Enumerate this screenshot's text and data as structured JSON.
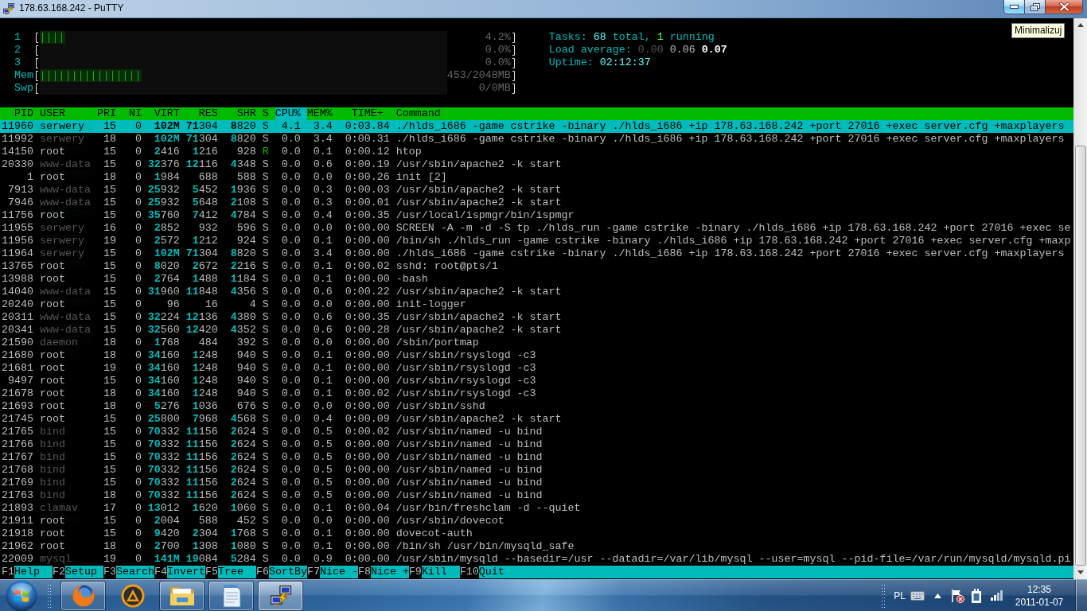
{
  "window": {
    "title": "178.63.168.242 - PuTTY",
    "buttons": [
      {
        "kind": "minimize",
        "hovered": true
      },
      {
        "kind": "restore",
        "hovered": false
      },
      {
        "kind": "close",
        "hovered": false
      }
    ],
    "tooltip": "Minimalizuj"
  },
  "meters": [
    {
      "label": "1",
      "level": 0.0625,
      "reading": "4.2%"
    },
    {
      "label": "2",
      "reading": "0.0%"
    },
    {
      "label": "3",
      "reading": "0.0%"
    },
    {
      "label": "Mem",
      "level": 0.25,
      "reading": "453/2048MB"
    },
    {
      "label": "Swp",
      "reading": "0/0MB"
    }
  ],
  "summary": [
    {
      "parts": [
        {
          "kind": "label",
          "text": "Tasks:"
        },
        {
          "kind": "value",
          "text": "68"
        },
        {
          "kind": "label",
          "text": "total,"
        },
        {
          "kind": "running",
          "text": "1"
        },
        {
          "kind": "label",
          "text": "running"
        }
      ]
    },
    {
      "parts": [
        {
          "kind": "label",
          "text": "Load average:"
        },
        {
          "kind": "dim",
          "text": "0.00"
        },
        {
          "kind": "plain",
          "text": "0.06"
        },
        {
          "kind": "bright",
          "text": "0.07"
        }
      ]
    },
    {
      "parts": [
        {
          "kind": "label",
          "text": "Uptime:"
        },
        {
          "kind": "value",
          "text": "02:12:37"
        }
      ]
    }
  ],
  "table": {
    "columns": [
      {
        "label": "PID",
        "selected": false
      },
      {
        "label": "USER",
        "selected": false
      },
      {
        "label": "PRI",
        "selected": false
      },
      {
        "label": "NI",
        "selected": false
      },
      {
        "label": "VIRT",
        "selected": false
      },
      {
        "label": "RES",
        "selected": false
      },
      {
        "label": "SHR",
        "selected": false
      },
      {
        "label": "S",
        "selected": false
      },
      {
        "label": "CPU%",
        "selected": true
      },
      {
        "label": "MEM%",
        "selected": false
      },
      {
        "label": "TIME+",
        "selected": false
      },
      {
        "label": "Command",
        "selected": false
      }
    ],
    "rows": [
      {
        "pid": "11960",
        "user": "serwery",
        "shadowed": true,
        "pri": "15",
        "ni": "0",
        "virt": "**102M**",
        "res": "**71**304",
        "shr": "**8**820",
        "state": "S",
        "running": false,
        "cpu": "4.1",
        "mem": "3.4",
        "time": "0:03.84",
        "command": "./hlds_i686 -game cstrike -binary ./hlds_i686 +ip 178.63.168.242 +port 27016 +exec server.cfg +maxplayers",
        "selected": true
      },
      {
        "pid": "11992",
        "user": "serwery",
        "shadowed": true,
        "pri": "18",
        "ni": "0",
        "virt": "**102M**",
        "res": "**71**304",
        "shr": "**8**820",
        "state": "S",
        "running": false,
        "cpu": "0.0",
        "mem": "3.4",
        "time": "0:00.31",
        "command": "./hlds_i686 -game cstrike -binary ./hlds_i686 +ip 178.63.168.242 +port 27016 +exec server.cfg +maxplayers",
        "selected": false
      },
      {
        "pid": "14150",
        "user": "root",
        "shadowed": false,
        "pri": "15",
        "ni": "0",
        "virt": "**2**416",
        "res": "**1**216",
        "shr": "928",
        "state": "R",
        "running": true,
        "cpu": "0.0",
        "mem": "0.1",
        "time": "0:00.12",
        "command": "htop",
        "selected": false
      },
      {
        "pid": "20330",
        "user": "www-data",
        "shadowed": true,
        "pri": "15",
        "ni": "0",
        "virt": "**32**376",
        "res": "**12**116",
        "shr": "**4**348",
        "state": "S",
        "running": false,
        "cpu": "0.0",
        "mem": "0.6",
        "time": "0:00.19",
        "command": "/usr/sbin/apache2 -k start",
        "selected": false
      },
      {
        "pid": "1",
        "user": "root",
        "shadowed": false,
        "pri": "18",
        "ni": "0",
        "virt": "**1**984",
        "res": "688",
        "shr": "588",
        "state": "S",
        "running": false,
        "cpu": "0.0",
        "mem": "0.0",
        "time": "0:00.26",
        "command": "init [2]",
        "selected": false
      },
      {
        "pid": "7913",
        "user": "www-data",
        "shadowed": true,
        "pri": "15",
        "ni": "0",
        "virt": "**25**932",
        "res": "**5**452",
        "shr": "**1**936",
        "state": "S",
        "running": false,
        "cpu": "0.0",
        "mem": "0.3",
        "time": "0:00.03",
        "command": "/usr/sbin/apache2 -k start",
        "selected": false
      },
      {
        "pid": "7946",
        "user": "www-data",
        "shadowed": true,
        "pri": "15",
        "ni": "0",
        "virt": "**25**932",
        "res": "**5**648",
        "shr": "**2**108",
        "state": "S",
        "running": false,
        "cpu": "0.0",
        "mem": "0.3",
        "time": "0:00.01",
        "command": "/usr/sbin/apache2 -k start",
        "selected": false
      },
      {
        "pid": "11756",
        "user": "root",
        "shadowed": false,
        "pri": "15",
        "ni": "0",
        "virt": "**35**760",
        "res": "**7**412",
        "shr": "**4**784",
        "state": "S",
        "running": false,
        "cpu": "0.0",
        "mem": "0.4",
        "time": "0:00.35",
        "command": "/usr/local/ispmgr/bin/ispmgr",
        "selected": false
      },
      {
        "pid": "11955",
        "user": "serwery",
        "shadowed": true,
        "pri": "16",
        "ni": "0",
        "virt": "**2**852",
        "res": "932",
        "shr": "596",
        "state": "S",
        "running": false,
        "cpu": "0.0",
        "mem": "0.0",
        "time": "0:00.00",
        "command": "SCREEN -A -m -d -S tp ./hlds_run -game cstrike -binary ./hlds_i686 +ip 178.63.168.242 +port 27016 +exec se",
        "selected": false
      },
      {
        "pid": "11956",
        "user": "serwery",
        "shadowed": true,
        "pri": "19",
        "ni": "0",
        "virt": "**2**572",
        "res": "**1**212",
        "shr": "924",
        "state": "S",
        "running": false,
        "cpu": "0.0",
        "mem": "0.1",
        "time": "0:00.00",
        "command": "/bin/sh ./hlds_run -game cstrike -binary ./hlds_i686 +ip 178.63.168.242 +port 27016 +exec server.cfg +maxp",
        "selected": false
      },
      {
        "pid": "11964",
        "user": "serwery",
        "shadowed": true,
        "pri": "15",
        "ni": "0",
        "virt": "**102M**",
        "res": "**71**304",
        "shr": "**8**820",
        "state": "S",
        "running": false,
        "cpu": "0.0",
        "mem": "3.4",
        "time": "0:00.00",
        "command": "./hlds_i686 -game cstrike -binary ./hlds_i686 +ip 178.63.168.242 +port 27016 +exec server.cfg +maxplayers",
        "selected": false
      },
      {
        "pid": "13765",
        "user": "root",
        "shadowed": false,
        "pri": "15",
        "ni": "0",
        "virt": "**8**020",
        "res": "**2**672",
        "shr": "**2**216",
        "state": "S",
        "running": false,
        "cpu": "0.0",
        "mem": "0.1",
        "time": "0:00.02",
        "command": "sshd: root@pts/1",
        "selected": false
      },
      {
        "pid": "13988",
        "user": "root",
        "shadowed": false,
        "pri": "15",
        "ni": "0",
        "virt": "**2**764",
        "res": "**1**488",
        "shr": "**1**184",
        "state": "S",
        "running": false,
        "cpu": "0.0",
        "mem": "0.1",
        "time": "0:00.00",
        "command": "-bash",
        "selected": false
      },
      {
        "pid": "14040",
        "user": "www-data",
        "shadowed": true,
        "pri": "15",
        "ni": "0",
        "virt": "**31**960",
        "res": "**11**848",
        "shr": "**4**356",
        "state": "S",
        "running": false,
        "cpu": "0.0",
        "mem": "0.6",
        "time": "0:00.22",
        "command": "/usr/sbin/apache2 -k start",
        "selected": false
      },
      {
        "pid": "20240",
        "user": "root",
        "shadowed": false,
        "pri": "15",
        "ni": "0",
        "virt": "96",
        "res": "16",
        "shr": "4",
        "state": "S",
        "running": false,
        "cpu": "0.0",
        "mem": "0.0",
        "time": "0:00.00",
        "command": "init-logger",
        "selected": false
      },
      {
        "pid": "20311",
        "user": "www-data",
        "shadowed": true,
        "pri": "15",
        "ni": "0",
        "virt": "**32**224",
        "res": "**12**136",
        "shr": "**4**380",
        "state": "S",
        "running": false,
        "cpu": "0.0",
        "mem": "0.6",
        "time": "0:00.35",
        "command": "/usr/sbin/apache2 -k start",
        "selected": false
      },
      {
        "pid": "20341",
        "user": "www-data",
        "shadowed": true,
        "pri": "15",
        "ni": "0",
        "virt": "**32**560",
        "res": "**12**420",
        "shr": "**4**352",
        "state": "S",
        "running": false,
        "cpu": "0.0",
        "mem": "0.6",
        "time": "0:00.28",
        "command": "/usr/sbin/apache2 -k start",
        "selected": false
      },
      {
        "pid": "21590",
        "user": "daemon",
        "shadowed": true,
        "pri": "18",
        "ni": "0",
        "virt": "**1**768",
        "res": "484",
        "shr": "392",
        "state": "S",
        "running": false,
        "cpu": "0.0",
        "mem": "0.0",
        "time": "0:00.00",
        "command": "/sbin/portmap",
        "selected": false
      },
      {
        "pid": "21680",
        "user": "root",
        "shadowed": false,
        "pri": "18",
        "ni": "0",
        "virt": "**34**160",
        "res": "**1**248",
        "shr": "940",
        "state": "S",
        "running": false,
        "cpu": "0.0",
        "mem": "0.1",
        "time": "0:00.00",
        "command": "/usr/sbin/rsyslogd -c3",
        "selected": false
      },
      {
        "pid": "21681",
        "user": "root",
        "shadowed": false,
        "pri": "19",
        "ni": "0",
        "virt": "**34**160",
        "res": "**1**248",
        "shr": "940",
        "state": "S",
        "running": false,
        "cpu": "0.0",
        "mem": "0.1",
        "time": "0:00.00",
        "command": "/usr/sbin/rsyslogd -c3",
        "selected": false
      },
      {
        "pid": "9497",
        "user": "root",
        "shadowed": false,
        "pri": "15",
        "ni": "0",
        "virt": "**34**160",
        "res": "**1**248",
        "shr": "940",
        "state": "S",
        "running": false,
        "cpu": "0.0",
        "mem": "0.1",
        "time": "0:00.00",
        "command": "/usr/sbin/rsyslogd -c3",
        "selected": false
      },
      {
        "pid": "21678",
        "user": "root",
        "shadowed": false,
        "pri": "18",
        "ni": "0",
        "virt": "**34**160",
        "res": "**1**248",
        "shr": "940",
        "state": "S",
        "running": false,
        "cpu": "0.0",
        "mem": "0.1",
        "time": "0:00.02",
        "command": "/usr/sbin/rsyslogd -c3",
        "selected": false
      },
      {
        "pid": "21693",
        "user": "root",
        "shadowed": false,
        "pri": "18",
        "ni": "0",
        "virt": "**5**276",
        "res": "**1**036",
        "shr": "676",
        "state": "S",
        "running": false,
        "cpu": "0.0",
        "mem": "0.0",
        "time": "0:00.00",
        "command": "/usr/sbin/sshd",
        "selected": false
      },
      {
        "pid": "21745",
        "user": "root",
        "shadowed": false,
        "pri": "15",
        "ni": "0",
        "virt": "**25**800",
        "res": "**7**968",
        "shr": "**4**568",
        "state": "S",
        "running": false,
        "cpu": "0.0",
        "mem": "0.4",
        "time": "0:00.09",
        "command": "/usr/sbin/apache2 -k start",
        "selected": false
      },
      {
        "pid": "21765",
        "user": "bind",
        "shadowed": true,
        "pri": "15",
        "ni": "0",
        "virt": "**70**332",
        "res": "**11**156",
        "shr": "**2**624",
        "state": "S",
        "running": false,
        "cpu": "0.0",
        "mem": "0.5",
        "time": "0:00.02",
        "command": "/usr/sbin/named -u bind",
        "selected": false
      },
      {
        "pid": "21766",
        "user": "bind",
        "shadowed": true,
        "pri": "15",
        "ni": "0",
        "virt": "**70**332",
        "res": "**11**156",
        "shr": "**2**624",
        "state": "S",
        "running": false,
        "cpu": "0.0",
        "mem": "0.5",
        "time": "0:00.00",
        "command": "/usr/sbin/named -u bind",
        "selected": false
      },
      {
        "pid": "21767",
        "user": "bind",
        "shadowed": true,
        "pri": "15",
        "ni": "0",
        "virt": "**70**332",
        "res": "**11**156",
        "shr": "**2**624",
        "state": "S",
        "running": false,
        "cpu": "0.0",
        "mem": "0.5",
        "time": "0:00.00",
        "command": "/usr/sbin/named -u bind",
        "selected": false
      },
      {
        "pid": "21768",
        "user": "bind",
        "shadowed": true,
        "pri": "15",
        "ni": "0",
        "virt": "**70**332",
        "res": "**11**156",
        "shr": "**2**624",
        "state": "S",
        "running": false,
        "cpu": "0.0",
        "mem": "0.5",
        "time": "0:00.00",
        "command": "/usr/sbin/named -u bind",
        "selected": false
      },
      {
        "pid": "21769",
        "user": "bind",
        "shadowed": true,
        "pri": "15",
        "ni": "0",
        "virt": "**70**332",
        "res": "**11**156",
        "shr": "**2**624",
        "state": "S",
        "running": false,
        "cpu": "0.0",
        "mem": "0.5",
        "time": "0:00.00",
        "command": "/usr/sbin/named -u bind",
        "selected": false
      },
      {
        "pid": "21763",
        "user": "bind",
        "shadowed": true,
        "pri": "18",
        "ni": "0",
        "virt": "**70**332",
        "res": "**11**156",
        "shr": "**2**624",
        "state": "S",
        "running": false,
        "cpu": "0.0",
        "mem": "0.5",
        "time": "0:00.00",
        "command": "/usr/sbin/named -u bind",
        "selected": false
      },
      {
        "pid": "21893",
        "user": "clamav",
        "shadowed": true,
        "pri": "17",
        "ni": "0",
        "virt": "**13**012",
        "res": "**1**620",
        "shr": "**1**060",
        "state": "S",
        "running": false,
        "cpu": "0.0",
        "mem": "0.1",
        "time": "0:00.04",
        "command": "/usr/bin/freshclam -d --quiet",
        "selected": false
      },
      {
        "pid": "21911",
        "user": "root",
        "shadowed": false,
        "pri": "15",
        "ni": "0",
        "virt": "**2**004",
        "res": "588",
        "shr": "452",
        "state": "S",
        "running": false,
        "cpu": "0.0",
        "mem": "0.0",
        "time": "0:00.00",
        "command": "/usr/sbin/dovecot",
        "selected": false
      },
      {
        "pid": "21918",
        "user": "root",
        "shadowed": false,
        "pri": "15",
        "ni": "0",
        "virt": "**9**420",
        "res": "**2**304",
        "shr": "**1**768",
        "state": "S",
        "running": false,
        "cpu": "0.0",
        "mem": "0.1",
        "time": "0:00.00",
        "command": "dovecot-auth",
        "selected": false
      },
      {
        "pid": "21962",
        "user": "root",
        "shadowed": false,
        "pri": "18",
        "ni": "0",
        "virt": "**2**700",
        "res": "**1**308",
        "shr": "**1**080",
        "state": "S",
        "running": false,
        "cpu": "0.0",
        "mem": "0.1",
        "time": "0:00.00",
        "command": "/bin/sh /usr/bin/mysqld_safe",
        "selected": false
      },
      {
        "pid": "22009",
        "user": "mysql",
        "shadowed": true,
        "pri": "19",
        "ni": "0",
        "virt": "**141M**",
        "res": "**19**084",
        "shr": "**5**284",
        "state": "S",
        "running": false,
        "cpu": "0.0",
        "mem": "0.9",
        "time": "0:00.00",
        "command": "/usr/sbin/mysqld --basedir=/usr --datadir=/var/lib/mysql --user=mysql --pid-file=/var/run/mysqld/mysqld.pi",
        "selected": false
      }
    ]
  },
  "function_keys": [
    {
      "key": "F1",
      "label": "Help"
    },
    {
      "key": "F2",
      "label": "Setup"
    },
    {
      "key": "F3",
      "label": "Search"
    },
    {
      "key": "F4",
      "label": "Invert"
    },
    {
      "key": "F5",
      "label": "Tree"
    },
    {
      "key": "F6",
      "label": "SortBy"
    },
    {
      "key": "F7",
      "label": "Nice -"
    },
    {
      "key": "F8",
      "label": "Nice +"
    },
    {
      "key": "F9",
      "label": "Kill"
    },
    {
      "key": "F10",
      "label": "Quit"
    }
  ],
  "taskbar": {
    "buttons": [
      {
        "kind": "browser",
        "running": true,
        "selected": false
      },
      {
        "kind": "player",
        "running": false,
        "selected": false
      },
      {
        "kind": "folder",
        "running": true,
        "selected": false
      },
      {
        "kind": "notepad",
        "running": true,
        "selected": false
      },
      {
        "kind": "terminal",
        "running": true,
        "selected": true
      }
    ],
    "language": "PL",
    "time": "12:35",
    "date": "2011-01-07"
  }
}
